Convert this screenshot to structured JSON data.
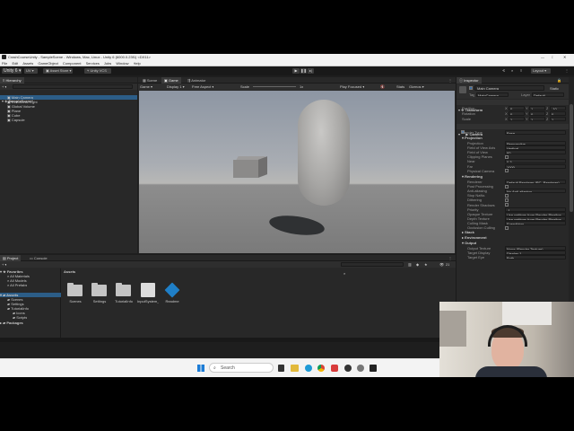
{
  "titlebar": {
    "title": "CrashCourseUnity - SampleScene - Windows, Mac, Linux - Unity 6 (6000.0.23f1) <DX11>"
  },
  "menu": [
    "File",
    "Edit",
    "Assets",
    "GameObject",
    "Component",
    "Services",
    "Jobs",
    "Window",
    "Help"
  ],
  "toolbar": {
    "account": "Unity 6",
    "cloud_label": "UV",
    "asset_store": "Asset Store",
    "vcs": "Unity VCS",
    "layout": "Layout"
  },
  "hierarchy": {
    "tab": "Hierarchy",
    "search_placeholder": "",
    "scene": "SampleScene*",
    "items": [
      "Main Camera",
      "Directional Light",
      "Global Volume",
      "Plane",
      "Cube",
      "Capsule"
    ]
  },
  "viewport": {
    "tabs": [
      "Scene",
      "Game",
      "Animator"
    ],
    "game_label": "Game",
    "display": "Display 1",
    "aspect": "Free Aspect",
    "scale_label": "Scale",
    "scale_value": "1x",
    "play_focused": "Play Focused",
    "stats": "Stats",
    "gizmos": "Gizmos"
  },
  "project": {
    "tabs": [
      "Project",
      "Console"
    ],
    "favorites": "Favorites",
    "fav_items": [
      "All Materials",
      "All Models",
      "All Prefabs"
    ],
    "assets": "Assets",
    "tree": [
      "Scenes",
      "Settings",
      "TutorialInfo",
      "Icons",
      "Scripts"
    ],
    "packages": "Packages",
    "breadcrumb": "Assets",
    "grid": [
      "Scenes",
      "Settings",
      "TutorialInfo",
      "InputSystem_...",
      "Readme"
    ],
    "count": "21"
  },
  "inspector": {
    "tab": "Inspector",
    "object_name": "Main Camera",
    "static": "Static",
    "tag_label": "Tag",
    "tag_value": "MainCamera",
    "layer_label": "Layer",
    "layer_value": "Default",
    "transform": {
      "title": "Transform",
      "rows": [
        {
          "label": "Position",
          "x": "0",
          "y": "1",
          "z": "-10"
        },
        {
          "label": "Rotation",
          "x": "0",
          "y": "0",
          "z": "0"
        },
        {
          "label": "Scale",
          "x": "1",
          "y": "1",
          "z": "1"
        }
      ]
    },
    "camera": {
      "title": "Camera",
      "render_type_label": "Render Type",
      "render_type": "Base",
      "projection_head": "Projection",
      "projection_rows": [
        {
          "label": "Projection",
          "value": "Perspective"
        },
        {
          "label": "Field of View Axis",
          "value": "Vertical"
        },
        {
          "label": "Field of View",
          "value": "60"
        },
        {
          "label": "Clipping Planes",
          "value": ""
        },
        {
          "label": "Near",
          "value": "0.3"
        },
        {
          "label": "Far",
          "value": "1000"
        },
        {
          "label": "Physical Camera",
          "value": ""
        }
      ],
      "rendering_head": "Rendering",
      "rendering_rows": [
        {
          "label": "Renderer",
          "value": "Default Renderer (PC_Renderer)"
        },
        {
          "label": "Post Processing",
          "value": ""
        },
        {
          "label": "Anti-aliasing",
          "value": "No Anti-aliasing"
        },
        {
          "label": "Stop NaNs",
          "value": ""
        },
        {
          "label": "Dithering",
          "value": ""
        },
        {
          "label": "Render Shadows",
          "value": ""
        },
        {
          "label": "Priority",
          "value": "-1"
        },
        {
          "label": "Opaque Texture",
          "value": "Use settings from Render Pipeline"
        },
        {
          "label": "Depth Texture",
          "value": "Use settings from Render Pipeline"
        },
        {
          "label": "Culling Mask",
          "value": "Everything"
        },
        {
          "label": "Occlusion Culling",
          "value": ""
        }
      ],
      "stack": "Stack",
      "environment": "Environment",
      "output_head": "Output",
      "output_rows": [
        {
          "label": "Output Texture",
          "value": "None (Render Texture)"
        },
        {
          "label": "Target Display",
          "value": "Display 1"
        },
        {
          "label": "Target Eye",
          "value": "Both"
        }
      ]
    }
  },
  "taskbar": {
    "search_placeholder": "Search"
  },
  "colors": {
    "accent": "#2c5d87",
    "sky_top": "#8a93a0",
    "ground": "#7c7c7d"
  }
}
